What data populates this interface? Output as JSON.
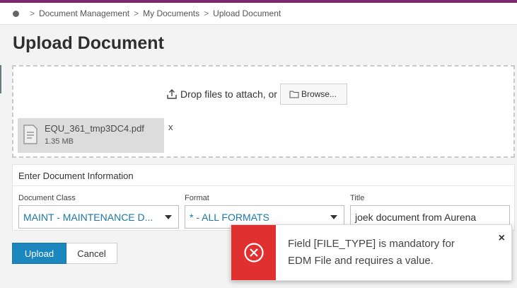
{
  "breadcrumb": {
    "items": [
      "Document Management",
      "My Documents",
      "Upload Document"
    ],
    "separator": ">"
  },
  "page": {
    "title": "Upload Document"
  },
  "dropzone": {
    "prompt": "Drop files to attach, or",
    "browse_label": "Browse..."
  },
  "file": {
    "name": "EQU_361_tmp3DC4.pdf",
    "size": "1.35 MB",
    "remove_label": "x"
  },
  "form": {
    "heading": "Enter Document Information",
    "document_class": {
      "label": "Document Class",
      "value": "MAINT - MAINTENANCE D..."
    },
    "format": {
      "label": "Format",
      "value": "* - ALL FORMATS"
    },
    "title": {
      "label": "Title",
      "value": "joek document from Aurena"
    }
  },
  "actions": {
    "upload_label": "Upload",
    "cancel_label": "Cancel"
  },
  "toast": {
    "message": "Field [FILE_TYPE] is mandatory for EDM File and requires a value.",
    "close_label": "×",
    "icon": "error-circle-x-icon",
    "color": "#e03030"
  },
  "colors": {
    "accent_bar": "#7b2a6f",
    "primary_button": "#1c86bf",
    "link_blue": "#1b77a6"
  }
}
